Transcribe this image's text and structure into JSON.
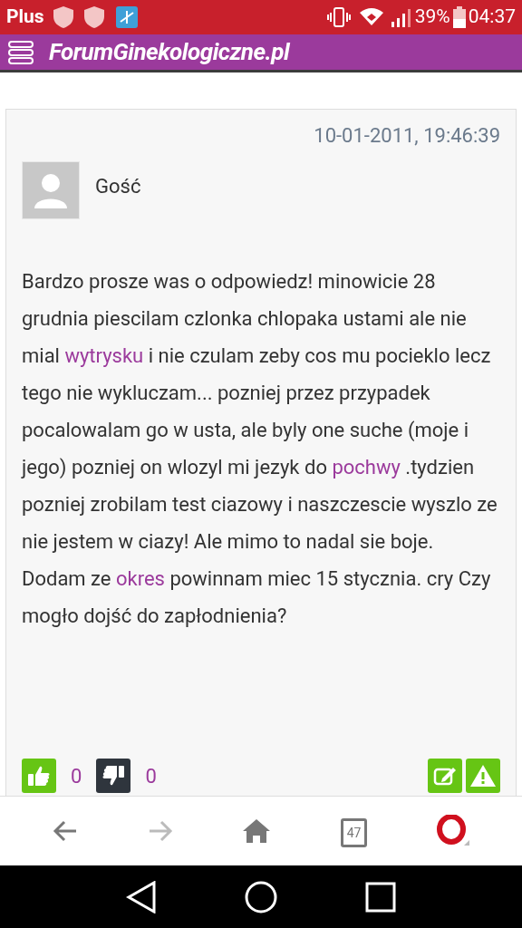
{
  "status_bar": {
    "carrier": "Plus",
    "battery": "39%",
    "time": "04:37"
  },
  "header": {
    "title": "ForumGinekologiczne.pl"
  },
  "post": {
    "date": "10-01-2011, 19:46:39",
    "author": "Gość",
    "body": [
      {
        "kind": "text",
        "text": "Bardzo prosze was o odpowiedz! minowicie 28 grudnia piescilam czlonka chlopaka ustami ale nie mial "
      },
      {
        "kind": "link",
        "text": "wytrysku"
      },
      {
        "kind": "text",
        "text": " i nie czulam zeby cos mu pocieklo lecz tego nie wykluczam... pozniej przez przypadek pocalowalam go w usta, ale byly one suche (moje i jego) pozniej on wlozyl mi jezyk do "
      },
      {
        "kind": "link",
        "text": "pochwy"
      },
      {
        "kind": "text",
        "text": " .tydzien pozniej zrobilam test ciazowy i naszczescie wyszlo ze nie jestem w ciazy! Ale mimo to nadal sie boje. Dodam ze "
      },
      {
        "kind": "link",
        "text": "okres"
      },
      {
        "kind": "text",
        "text": " powinnam miec 15 stycznia. cry Czy mogło dojść do zapłodnienia?"
      }
    ],
    "likes": "0",
    "dislikes": "0"
  },
  "browser_bar": {
    "tabs_count": "47"
  }
}
